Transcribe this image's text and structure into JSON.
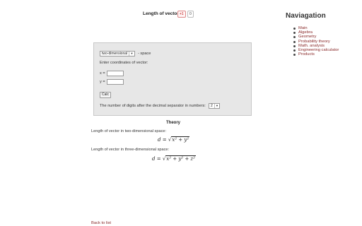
{
  "header": {
    "title": "Length of vector",
    "share_badge": "+1",
    "share_count": "0"
  },
  "navigation": {
    "title": "Naviagation",
    "items": [
      {
        "label": "Main"
      },
      {
        "label": "Algebra"
      },
      {
        "label": "Geometry"
      },
      {
        "label": "Probability theory"
      },
      {
        "label": "Math. analysis"
      },
      {
        "label": "Engineering calculator"
      },
      {
        "label": "Products"
      }
    ]
  },
  "calculator": {
    "space_selected": "two-dimensional",
    "space_suffix": "- space",
    "coords_prompt": "Enter coordinates of vector:",
    "x_label": "x =",
    "y_label": "y =",
    "x_value": "",
    "y_value": "",
    "calc_label": "Calc",
    "digits_prompt": "The number of digits after the decimal separator in numbers:",
    "digits_value": "2"
  },
  "theory": {
    "title": "Theory",
    "text_2d": "Length of vector in two-dimensional space:",
    "formula_2d": {
      "lhs": "d =",
      "radicand": "x² + y²"
    },
    "text_3d": "Length of vector in three-dimensional space:",
    "formula_3d": {
      "lhs": "d =",
      "radicand": "x² + y² + z²"
    }
  },
  "footer": {
    "back_link": "Back to list"
  }
}
